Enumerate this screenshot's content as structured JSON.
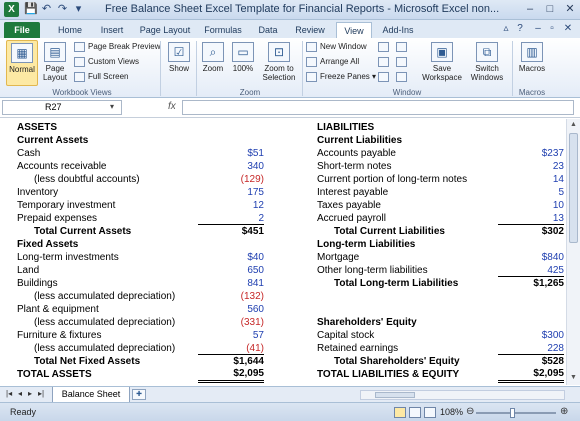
{
  "window": {
    "title": "Free Balance Sheet Excel Template for Financial Reports - Microsoft Excel non...",
    "app_icon": "X"
  },
  "qat": {
    "save_icon": "💾",
    "undo_icon": "↶",
    "redo_icon": "↷",
    "customize_icon": "▾"
  },
  "tabs": [
    {
      "label": "File"
    },
    {
      "label": "Home"
    },
    {
      "label": "Insert"
    },
    {
      "label": "Page Layout"
    },
    {
      "label": "Formulas"
    },
    {
      "label": "Data"
    },
    {
      "label": "Review"
    },
    {
      "label": "View"
    },
    {
      "label": "Add-Ins"
    }
  ],
  "ribbon": {
    "workbook_views": {
      "normal": "Normal",
      "page_layout": "Page Layout",
      "page_break_preview": "Page Break Preview",
      "custom_views": "Custom Views",
      "full_screen": "Full Screen",
      "group_label": "Workbook Views"
    },
    "show": {
      "label": "Show"
    },
    "zoom": {
      "zoom": "Zoom",
      "hundred": "100%",
      "zoom_to_selection": "Zoom to Selection",
      "group_label": "Zoom"
    },
    "window": {
      "new_window": "New Window",
      "arrange_all": "Arrange All",
      "freeze_panes": "Freeze Panes",
      "save_workspace": "Save Workspace",
      "switch_windows": "Switch Windows",
      "group_label": "Window"
    },
    "macros": {
      "label": "Macros",
      "group_label": "Macros"
    }
  },
  "formula_bar": {
    "name_box": "R27",
    "fx": "fx",
    "formula": ""
  },
  "sheet": {
    "assets_header": "ASSETS",
    "current_assets_header": "Current Assets",
    "current_assets": [
      {
        "label": "Cash",
        "value": "$51",
        "color": "blue",
        "indent": 0
      },
      {
        "label": "Accounts receivable",
        "value": "340",
        "color": "blue",
        "indent": 0
      },
      {
        "label": "(less doubtful accounts)",
        "value": "(129)",
        "color": "red",
        "indent": 1
      },
      {
        "label": "Inventory",
        "value": "175",
        "color": "blue",
        "indent": 0
      },
      {
        "label": "Temporary investment",
        "value": "12",
        "color": "blue",
        "indent": 0
      },
      {
        "label": "Prepaid expenses",
        "value": "2",
        "color": "blue",
        "indent": 0
      }
    ],
    "total_current_assets": {
      "label": "Total Current Assets",
      "value": "$451"
    },
    "fixed_assets_header": "Fixed Assets",
    "fixed_assets": [
      {
        "label": "Long-term investments",
        "value": "$40",
        "color": "blue",
        "indent": 0
      },
      {
        "label": "Land",
        "value": "650",
        "color": "blue",
        "indent": 0
      },
      {
        "label": "Buildings",
        "value": "841",
        "color": "blue",
        "indent": 0
      },
      {
        "label": "(less accumulated depreciation)",
        "value": "(132)",
        "color": "red",
        "indent": 1
      },
      {
        "label": "Plant & equipment",
        "value": "560",
        "color": "blue",
        "indent": 0
      },
      {
        "label": "(less accumulated depreciation)",
        "value": "(331)",
        "color": "red",
        "indent": 1
      },
      {
        "label": "Furniture & fixtures",
        "value": "57",
        "color": "blue",
        "indent": 0
      },
      {
        "label": "(less accumulated depreciation)",
        "value": "(41)",
        "color": "red",
        "indent": 1
      }
    ],
    "total_net_fixed_assets": {
      "label": "Total Net Fixed Assets",
      "value": "$1,644"
    },
    "total_assets": {
      "label": "TOTAL ASSETS",
      "value": "$2,095"
    },
    "liabilities_header": "LIABILITIES",
    "current_liabilities_header": "Current Liabilities",
    "current_liabilities": [
      {
        "label": "Accounts payable",
        "value": "$237",
        "color": "blue"
      },
      {
        "label": "Short-term notes",
        "value": "23",
        "color": "blue"
      },
      {
        "label": "Current portion of long-term notes",
        "value": "14",
        "color": "blue"
      },
      {
        "label": "Interest payable",
        "value": "5",
        "color": "blue"
      },
      {
        "label": "Taxes payable",
        "value": "10",
        "color": "blue"
      },
      {
        "label": "Accrued payroll",
        "value": "13",
        "color": "blue"
      }
    ],
    "total_current_liabilities": {
      "label": "Total Current Liabilities",
      "value": "$302"
    },
    "long_term_liabilities_header": "Long-term Liabilities",
    "long_term_liabilities": [
      {
        "label": "Mortgage",
        "value": "$840",
        "color": "blue"
      },
      {
        "label": "Other long-term liabilities",
        "value": "425",
        "color": "blue"
      }
    ],
    "total_long_term_liabilities": {
      "label": "Total Long-term Liabilities",
      "value": "$1,265"
    },
    "equity_header": "Shareholders' Equity",
    "equity": [
      {
        "label": "Capital stock",
        "value": "$300",
        "color": "blue"
      },
      {
        "label": "Retained earnings",
        "value": "228",
        "color": "blue"
      }
    ],
    "total_equity": {
      "label": "Total Shareholders' Equity",
      "value": "$528"
    },
    "total_liabilities_equity": {
      "label": "TOTAL LIABILITIES & EQUITY",
      "value": "$2,095"
    }
  },
  "sheet_tabs": {
    "active": "Balance Sheet"
  },
  "status": {
    "ready": "Ready",
    "zoom": "108%"
  },
  "colors": {
    "value_blue": "#1f3fb0",
    "value_red": "#c62828",
    "file_tab": "#1e7a3c"
  }
}
